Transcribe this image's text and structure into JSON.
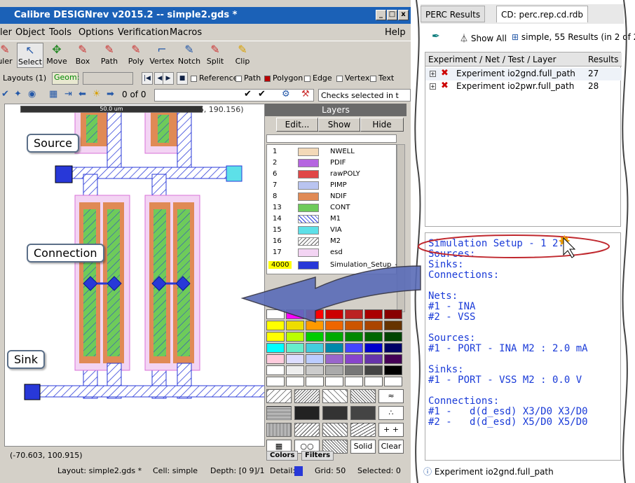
{
  "window": {
    "title": "Calibre DESIGNrev v2015.2  --  simple2.gds *",
    "min_label": "_",
    "max_label": "□",
    "close_label": "x"
  },
  "menu": [
    "ler",
    "Object",
    "Tools",
    "Options",
    "Verification",
    "Macros",
    "Help"
  ],
  "toolbar": [
    {
      "label": "uler",
      "icon": "ruler-icon",
      "glyph": "✎"
    },
    {
      "label": "Select",
      "icon": "select-arrow-icon",
      "glyph": "↖"
    },
    {
      "label": "Move",
      "icon": "move-icon",
      "glyph": "✥"
    },
    {
      "label": "Box",
      "icon": "box-icon",
      "glyph": "✎"
    },
    {
      "label": "Path",
      "icon": "path-icon",
      "glyph": "✎"
    },
    {
      "label": "Poly",
      "icon": "poly-icon",
      "glyph": "✎"
    },
    {
      "label": "Vertex",
      "icon": "vertex-icon",
      "glyph": "⌐"
    },
    {
      "label": "Notch",
      "icon": "notch-icon",
      "glyph": "✎"
    },
    {
      "label": "Split",
      "icon": "split-icon",
      "glyph": "✎"
    },
    {
      "label": "Clip",
      "icon": "clip-icon",
      "glyph": "✎"
    }
  ],
  "selection": {
    "layouts": "Layouts (1)",
    "geom": "Geom:",
    "filters": [
      {
        "label": "Reference",
        "checked": false
      },
      {
        "label": "Path",
        "checked": false
      },
      {
        "label": "Polygon",
        "checked": true
      },
      {
        "label": "Edge",
        "checked": false
      },
      {
        "label": "Vertex",
        "checked": false
      },
      {
        "label": "Text",
        "checked": false
      }
    ]
  },
  "iconbar": {
    "page_count": "0 of 0",
    "checks_placeholder": "Checks selected in t"
  },
  "canvas": {
    "scale_label": "50.0 um",
    "cursor_coords": "(- 06, 190.156)",
    "bottom_coords": "(-70.603, 100.915)"
  },
  "layers_panel": {
    "title": "Layers",
    "edit_label": "Edit...",
    "show_label": "Show",
    "hide_label": "Hide",
    "layers": [
      {
        "num": "1",
        "name": "NWELL",
        "color": "#f3d9b8"
      },
      {
        "num": "2",
        "name": "PDIF",
        "color": "#b565e0"
      },
      {
        "num": "6",
        "name": "rawPOLY",
        "color": "#e04747"
      },
      {
        "num": "7",
        "name": "PIMP",
        "color": "#b9c4f0"
      },
      {
        "num": "8",
        "name": "NDIF",
        "color": "#e08a55"
      },
      {
        "num": "13",
        "name": "CONT",
        "color": "#6ecb5a"
      },
      {
        "num": "14",
        "name": "M1",
        "color": "#ffffff"
      },
      {
        "num": "15",
        "name": "VIA",
        "color": "#5de0e8"
      },
      {
        "num": "16",
        "name": "M2",
        "color": "#ffffff"
      },
      {
        "num": "17",
        "name": "esd",
        "color": "#f3d4f3"
      },
      {
        "num": "4000",
        "name": "Simulation_Setup_-",
        "color": "#2838d8"
      }
    ],
    "solid_label": "Solid",
    "clear_label": "Clear",
    "tab_colors": "Colors",
    "tab_filters": "Filters"
  },
  "callouts": {
    "source": "Source",
    "connection": "Connection",
    "sink": "Sink"
  },
  "status": {
    "layout": "Layout:  simple2.gds *",
    "cell": "Cell:  simple",
    "depth": "Depth:  [0 9]/1",
    "detail": "Detail:",
    "grid": "Grid:  50",
    "selected": "Selected:  0"
  },
  "perc": {
    "tab1": "PERC Results",
    "tab2": "CD: perc.rep.cd.rdb",
    "show_all": "Show All",
    "results_summary": "simple, 55 Results (in 2 of 2",
    "col_exp": "Experiment / Net / Test / Layer",
    "col_results": "Results",
    "rows": [
      {
        "name": "Experiment io2gnd.full_path",
        "count": "27"
      },
      {
        "name": "Experiment io2pwr.full_path",
        "count": "28"
      }
    ],
    "console_lines": [
      "Simulation Setup - 1 2:",
      "Sources:",
      "Sinks:",
      "Connections:",
      "",
      "Nets:",
      "#1 - INA",
      "#2 - VSS",
      "",
      "Sources:",
      "#1 - PORT - INA M2 : 2.0 mA",
      "",
      "Sinks:",
      "#1 - PORT - VSS M2 : 0.0 V",
      "",
      "Connections:",
      "#1 -   d(d_esd) X3/D0 X3/D0",
      "#2 -   d(d_esd) X5/D0 X5/D0"
    ],
    "status": "Experiment io2gnd.full_path"
  }
}
